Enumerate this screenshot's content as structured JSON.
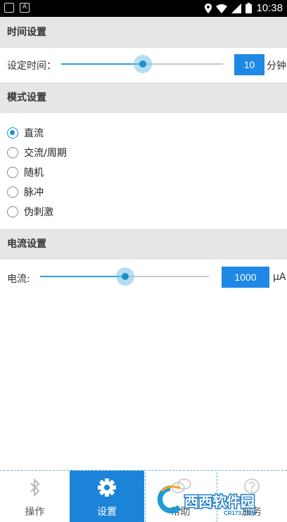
{
  "status_bar": {
    "time": "10:38",
    "left_badge": "A",
    "icons": [
      "location-icon",
      "wifi-icon",
      "signal-icon",
      "battery-icon"
    ]
  },
  "time_section": {
    "header": "时间设置",
    "label": "设定时间：",
    "value": "10",
    "unit": "分钟",
    "slider_fraction": 0.5
  },
  "mode_section": {
    "header": "模式设置",
    "options": [
      {
        "label": "直流",
        "checked": true
      },
      {
        "label": "交流/周期",
        "checked": false
      },
      {
        "label": "随机",
        "checked": false
      },
      {
        "label": "脉冲",
        "checked": false
      },
      {
        "label": "伪刺激",
        "checked": false
      }
    ]
  },
  "current_section": {
    "header": "电流设置",
    "label": "电流:",
    "value": "1000",
    "unit": "μA",
    "slider_fraction": 0.5
  },
  "bottom_nav": {
    "items": [
      {
        "label": "操作",
        "icon": "bluetooth-icon",
        "active": false
      },
      {
        "label": "设置",
        "icon": "gear-icon",
        "active": true
      },
      {
        "label": "帮助",
        "icon": "chat-icon",
        "active": false
      },
      {
        "label": "服务",
        "icon": "question-icon",
        "active": false
      }
    ]
  },
  "watermark": {
    "brand": "西西软件园",
    "url": "CR173.COM"
  },
  "colors": {
    "accent": "#1b91cc",
    "value_box": "#1e88e5",
    "nav_active": "#1b84d8",
    "header_bg": "#e6e6e6"
  }
}
